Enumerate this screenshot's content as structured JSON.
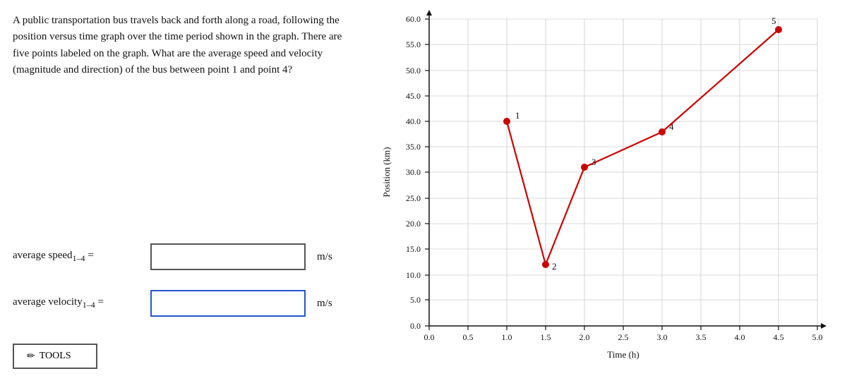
{
  "problem": {
    "text": "A public transportation bus travels back and forth along a road, following the position versus time graph over the time period shown in the graph. There are five points labeled on the graph. What are the average speed and velocity (magnitude and direction) of the bus between point 1 and point 4?"
  },
  "inputs": {
    "average_speed_label": "average speed",
    "average_speed_subscript": "1–4",
    "average_speed_placeholder": "",
    "average_speed_unit": "m/s",
    "average_velocity_label": "average velocity",
    "average_velocity_subscript": "1–4",
    "average_velocity_placeholder": "",
    "average_velocity_unit": "m/s"
  },
  "tools": {
    "label": "TOOLS",
    "icon": "pencil"
  },
  "chart": {
    "x_axis_label": "Time (h)",
    "y_axis_label": "Position (km)",
    "x_ticks": [
      "0.0",
      "0.5",
      "1.0",
      "1.5",
      "2.0",
      "2.5",
      "3.0",
      "3.5",
      "4.0",
      "4.5",
      "5.0"
    ],
    "y_ticks": [
      "0.0",
      "5.0",
      "10.0",
      "15.0",
      "20.0",
      "25.0",
      "30.0",
      "35.0",
      "40.0",
      "45.0",
      "50.0",
      "55.0",
      "60.0"
    ],
    "points": [
      {
        "id": "1",
        "x": 1.0,
        "y": 40.0
      },
      {
        "id": "2",
        "x": 1.5,
        "y": 12.0
      },
      {
        "id": "3",
        "x": 2.0,
        "y": 31.0
      },
      {
        "id": "4",
        "x": 3.0,
        "y": 38.0
      },
      {
        "id": "5",
        "x": 4.5,
        "y": 58.0
      }
    ]
  }
}
